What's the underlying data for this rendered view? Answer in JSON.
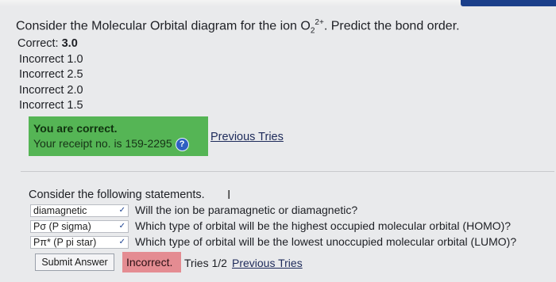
{
  "question": {
    "prefix": "Consider the Molecular Orbital diagram for the ion O",
    "sub": "2",
    "sup": "2+",
    "suffix": ". Predict the bond order."
  },
  "answers": {
    "correct_label": "Correct:",
    "correct_value": "3.0",
    "incorrect": [
      "Incorrect 1.0",
      "Incorrect 2.5",
      "Incorrect 2.0",
      "Incorrect 1.5"
    ]
  },
  "result": {
    "title": "You are correct.",
    "receipt": "Your receipt no. is 159-2295",
    "help": "?"
  },
  "previous_tries_1": "Previous Tries",
  "statements": {
    "heading": "Consider the following statements.",
    "cursor": "I",
    "rows": [
      {
        "selected": "diamagnetic",
        "text": "Will the ion be paramagnetic or diamagnetic?"
      },
      {
        "selected": "Pσ (P sigma)",
        "text": "Which type of orbital will be the highest occupied molecular orbital (HOMO)?"
      },
      {
        "selected": "Pπ* (P pi star)",
        "text": "Which type of orbital will be the lowest unoccupied molecular orbital (LUMO)?"
      }
    ]
  },
  "submit_label": "Submit Answer",
  "status": {
    "incorrect_label": "Incorrect.",
    "tries": "Tries 1/2",
    "previous_tries": "Previous Tries"
  },
  "colors": {
    "correct_bg": "#55b555",
    "incorrect_bg": "#e48c92",
    "link": "#1d2a5a"
  }
}
